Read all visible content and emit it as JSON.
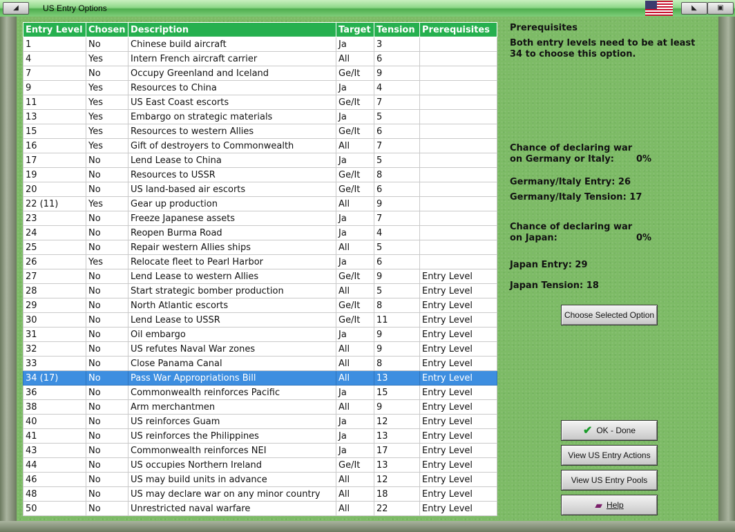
{
  "window": {
    "title": "US Entry Options",
    "minimize_glyph": "◢",
    "restore_glyph": "◣",
    "close_glyph": "▣"
  },
  "table": {
    "headers": [
      "Entry Level",
      "Chosen",
      "Description",
      "Target",
      "Tension",
      "Prerequisites"
    ],
    "rows": [
      [
        "1",
        "No",
        "Chinese build aircraft",
        "Ja",
        "3",
        ""
      ],
      [
        "4",
        "Yes",
        "Intern French aircraft carrier",
        "All",
        "6",
        ""
      ],
      [
        "7",
        "No",
        "Occupy Greenland and Iceland",
        "Ge/It",
        "9",
        ""
      ],
      [
        "9",
        "Yes",
        "Resources to China",
        "Ja",
        "4",
        ""
      ],
      [
        "11",
        "Yes",
        "US East Coast escorts",
        "Ge/It",
        "7",
        ""
      ],
      [
        "13",
        "Yes",
        "Embargo on strategic materials",
        "Ja",
        "5",
        ""
      ],
      [
        "15",
        "Yes",
        "Resources to western Allies",
        "Ge/It",
        "6",
        ""
      ],
      [
        "16",
        "Yes",
        "Gift of destroyers to Commonwealth",
        "All",
        "7",
        ""
      ],
      [
        "17",
        "No",
        "Lend Lease to China",
        "Ja",
        "5",
        ""
      ],
      [
        "19",
        "No",
        "Resources to USSR",
        "Ge/It",
        "8",
        ""
      ],
      [
        "20",
        "No",
        "US land-based air escorts",
        "Ge/It",
        "6",
        ""
      ],
      [
        "22 (11)",
        "Yes",
        "Gear up production",
        "All",
        "9",
        ""
      ],
      [
        "23",
        "No",
        "Freeze Japanese assets",
        "Ja",
        "7",
        ""
      ],
      [
        "24",
        "No",
        "Reopen Burma Road",
        "Ja",
        "4",
        ""
      ],
      [
        "25",
        "No",
        "Repair western Allies ships",
        "All",
        "5",
        ""
      ],
      [
        "26",
        "Yes",
        "Relocate fleet to Pearl Harbor",
        "Ja",
        "6",
        ""
      ],
      [
        "27",
        "No",
        "Lend Lease to western Allies",
        "Ge/It",
        "9",
        "Entry Level"
      ],
      [
        "28",
        "No",
        "Start strategic bomber production",
        "All",
        "5",
        "Entry Level"
      ],
      [
        "29",
        "No",
        "North Atlantic escorts",
        "Ge/It",
        "8",
        "Entry Level"
      ],
      [
        "30",
        "No",
        "Lend Lease to USSR",
        "Ge/It",
        "11",
        "Entry Level"
      ],
      [
        "31",
        "No",
        "Oil embargo",
        "Ja",
        "9",
        "Entry Level"
      ],
      [
        "32",
        "No",
        "US refutes Naval War zones",
        "All",
        "9",
        "Entry Level"
      ],
      [
        "33",
        "No",
        "Close Panama Canal",
        "All",
        "8",
        "Entry Level"
      ],
      [
        "34 (17)",
        "No",
        "Pass War Appropriations Bill",
        "All",
        "13",
        "Entry Level"
      ],
      [
        "36",
        "No",
        "Commonwealth reinforces Pacific",
        "Ja",
        "15",
        "Entry Level"
      ],
      [
        "38",
        "No",
        "Arm merchantmen",
        "All",
        "9",
        "Entry Level"
      ],
      [
        "40",
        "No",
        "US reinforces Guam",
        "Ja",
        "12",
        "Entry Level"
      ],
      [
        "41",
        "No",
        "US reinforces the Philippines",
        "Ja",
        "13",
        "Entry Level"
      ],
      [
        "43",
        "No",
        "Commonwealth reinforces NEI",
        "Ja",
        "17",
        "Entry Level"
      ],
      [
        "44",
        "No",
        "US occupies Northern Ireland",
        "Ge/It",
        "13",
        "Entry Level"
      ],
      [
        "46",
        "No",
        "US may build units in advance",
        "All",
        "12",
        "Entry Level"
      ],
      [
        "48",
        "No",
        "US may declare war on any minor country",
        "All",
        "18",
        "Entry Level"
      ],
      [
        "50",
        "No",
        "Unrestricted naval warfare",
        "All",
        "22",
        "Entry Level"
      ]
    ],
    "selected_index": 23
  },
  "panel": {
    "prereq_title": "Prerequisites",
    "prereq_line1": "Both entry levels need to be at least",
    "prereq_line2": "34 to choose this option.",
    "ge_chance_line1": "Chance of declaring war",
    "ge_chance_line2": "on Germany or Italy:",
    "ge_chance_value": "0%",
    "ge_entry": "Germany/Italy Entry: 26",
    "ge_tension": "Germany/Italy Tension: 17",
    "ja_chance_line1": "Chance of declaring war",
    "ja_chance_line2": "on Japan:",
    "ja_chance_value": "0%",
    "ja_entry": "Japan Entry: 29",
    "ja_tension": "Japan Tension: 18"
  },
  "buttons": {
    "choose": "Choose Selected Option",
    "ok": "OK - Done",
    "actions": "View US Entry Actions",
    "pools": "View US Entry Pools",
    "help": "Help"
  },
  "colors": {
    "header": "#26b04f",
    "selected_row": "#3d8ee0",
    "background": "#7dbb66"
  }
}
